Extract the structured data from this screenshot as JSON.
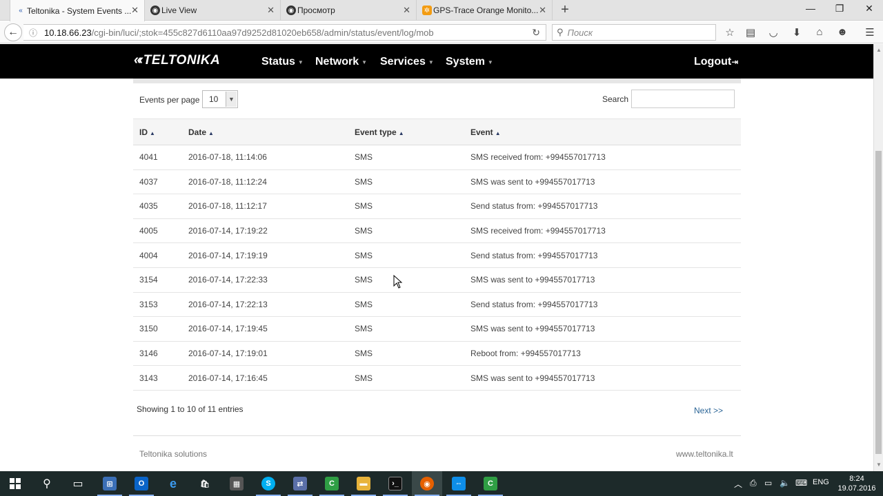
{
  "browser": {
    "tabs": [
      {
        "label": "Teltonika - System Events ...",
        "active": true
      },
      {
        "label": "Live View",
        "active": false
      },
      {
        "label": "Просмотр",
        "active": false
      },
      {
        "label": "GPS-Trace Orange Monito...",
        "active": false
      }
    ],
    "url_host": "10.18.66.23",
    "url_path": "/cgi-bin/luci/;stok=455c827d6110aa97d9252d81020eb658/admin/status/event/log/mob",
    "search_placeholder": "Поиск"
  },
  "header": {
    "logo": "TELTONIKA",
    "menu": [
      "Status",
      "Network",
      "Services",
      "System"
    ],
    "logout": "Logout"
  },
  "controls": {
    "events_per_page_label": "Events per page",
    "events_per_page_value": "10",
    "search_label": "Search"
  },
  "table": {
    "columns": [
      "ID",
      "Date",
      "Event type",
      "Event"
    ],
    "rows": [
      [
        "4041",
        "2016-07-18, 11:14:06",
        "SMS",
        "SMS received from: +994557017713"
      ],
      [
        "4037",
        "2016-07-18, 11:12:24",
        "SMS",
        "SMS was sent to +994557017713"
      ],
      [
        "4035",
        "2016-07-18, 11:12:17",
        "SMS",
        "Send status from: +994557017713"
      ],
      [
        "4005",
        "2016-07-14, 17:19:22",
        "SMS",
        "SMS received from: +994557017713"
      ],
      [
        "4004",
        "2016-07-14, 17:19:19",
        "SMS",
        "Send status from: +994557017713"
      ],
      [
        "3154",
        "2016-07-14, 17:22:33",
        "SMS",
        "SMS was sent to +994557017713"
      ],
      [
        "3153",
        "2016-07-14, 17:22:13",
        "SMS",
        "Send status from: +994557017713"
      ],
      [
        "3150",
        "2016-07-14, 17:19:45",
        "SMS",
        "SMS was sent to +994557017713"
      ],
      [
        "3146",
        "2016-07-14, 17:19:01",
        "SMS",
        "Reboot from: +994557017713"
      ],
      [
        "3143",
        "2016-07-14, 17:16:45",
        "SMS",
        "SMS was sent to +994557017713"
      ]
    ]
  },
  "pagination": {
    "info": "Showing 1 to 10 of 11 entries",
    "next": "Next >>"
  },
  "footer": {
    "left": "Teltonika solutions",
    "right": "www.teltonika.lt"
  },
  "taskbar": {
    "language": "ENG",
    "time": "8:24",
    "date": "19.07.2016"
  },
  "colors": {
    "header_bg": "#000000",
    "link": "#2a6496",
    "taskbar_bg": "#1d2a2a"
  }
}
